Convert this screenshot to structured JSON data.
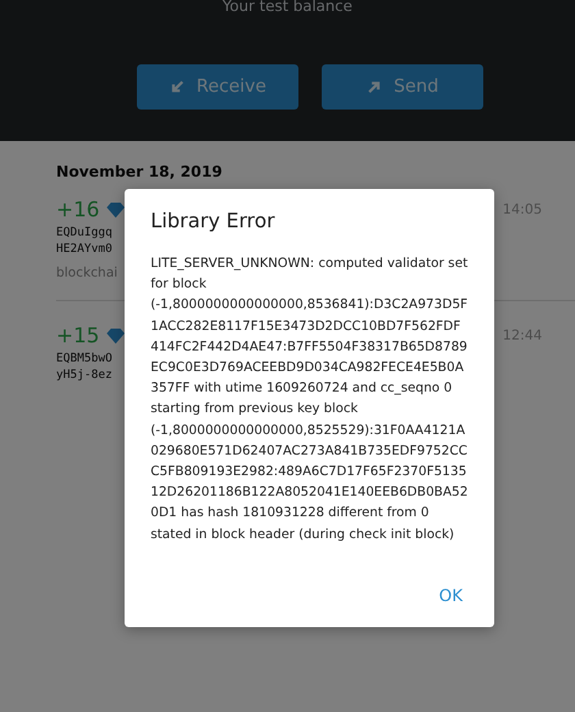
{
  "header": {
    "balance_label": "Your test balance",
    "buttons": [
      {
        "kind": "receive",
        "label": "Receive"
      },
      {
        "kind": "send",
        "label": "Send"
      }
    ]
  },
  "transactions": {
    "date": "November 18, 2019",
    "items": [
      {
        "amount": "+16",
        "address_lines": [
          "EQDuIggq",
          "HE2AYvm0"
        ],
        "comment": "blockchai",
        "time": "14:05"
      },
      {
        "amount": "+15",
        "address_lines": [
          "EQBM5bwO",
          "yH5j-8ez"
        ],
        "time": "12:44"
      }
    ]
  },
  "dialog": {
    "title": "Library Error",
    "message": "LITE_SERVER_UNKNOWN: computed validator set for block (-1,8000000000000000,8536841):D3C2A973D5F1ACC282E8117F15E3473D2DCC10BD7F562FDF414FC2F442D4AE47:B7FF5504F38317B65D8789EC9C0E3D769ACEEBD9D034CA982FECE4E5B0A357FF with utime 1609260724 and cc_seqno 0 starting from previous key block (-1,8000000000000000,8525529):31F0AA4121A029680E571D62407AC273A841B735EDF9752CCC5FB809193E2982:489A6C7D17F65F2370F513512D26201186B122A8052041E140EEB6DB0BA520D1 has hash 1810931228 different from 0 stated in block header (during check init block)",
    "button": "OK"
  }
}
